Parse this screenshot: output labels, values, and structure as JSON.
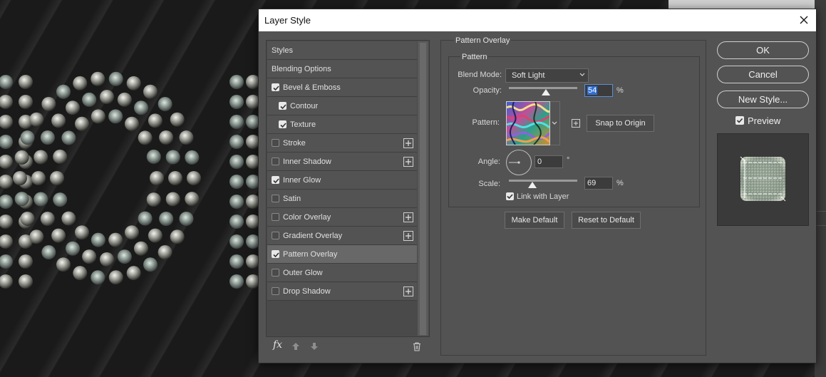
{
  "dialog": {
    "title": "Layer Style"
  },
  "styles_list": [
    {
      "label": "Styles",
      "checkbox": null,
      "plus": false,
      "indent": false,
      "selected": false
    },
    {
      "label": "Blending Options",
      "checkbox": null,
      "plus": false,
      "indent": false,
      "selected": false
    },
    {
      "label": "Bevel & Emboss",
      "checkbox": true,
      "plus": false,
      "indent": false,
      "selected": false
    },
    {
      "label": "Contour",
      "checkbox": true,
      "plus": false,
      "indent": true,
      "selected": false
    },
    {
      "label": "Texture",
      "checkbox": true,
      "plus": false,
      "indent": true,
      "selected": false
    },
    {
      "label": "Stroke",
      "checkbox": false,
      "plus": true,
      "indent": false,
      "selected": false
    },
    {
      "label": "Inner Shadow",
      "checkbox": false,
      "plus": true,
      "indent": false,
      "selected": false
    },
    {
      "label": "Inner Glow",
      "checkbox": true,
      "plus": false,
      "indent": false,
      "selected": false
    },
    {
      "label": "Satin",
      "checkbox": false,
      "plus": false,
      "indent": false,
      "selected": false
    },
    {
      "label": "Color Overlay",
      "checkbox": false,
      "plus": true,
      "indent": false,
      "selected": false
    },
    {
      "label": "Gradient Overlay",
      "checkbox": false,
      "plus": true,
      "indent": false,
      "selected": false
    },
    {
      "label": "Pattern Overlay",
      "checkbox": true,
      "plus": false,
      "indent": false,
      "selected": true
    },
    {
      "label": "Outer Glow",
      "checkbox": false,
      "plus": false,
      "indent": false,
      "selected": false
    },
    {
      "label": "Drop Shadow",
      "checkbox": false,
      "plus": true,
      "indent": false,
      "selected": false
    }
  ],
  "footer": {
    "fx_label": "fx",
    "icons": [
      "fx-icon",
      "move-up-icon",
      "move-down-icon",
      "trash-icon"
    ]
  },
  "pattern_overlay": {
    "group_title": "Pattern Overlay",
    "subgroup_title": "Pattern",
    "blend_mode_label": "Blend Mode:",
    "blend_mode_value": "Soft Light",
    "opacity_label": "Opacity:",
    "opacity_value": "54",
    "opacity_unit": "%",
    "opacity_percent": 54,
    "pattern_label": "Pattern:",
    "snap_button": "Snap to Origin",
    "angle_label": "Angle:",
    "angle_value": "0",
    "angle_unit": "°",
    "scale_label": "Scale:",
    "scale_value": "69",
    "scale_unit": "%",
    "scale_percent": 69,
    "link_label": "Link with Layer",
    "link_checked": true,
    "make_default": "Make Default",
    "reset_default": "Reset to Default"
  },
  "actions": {
    "ok": "OK",
    "cancel": "Cancel",
    "new_style": "New Style...",
    "preview_label": "Preview",
    "preview_checked": true
  },
  "colors": {
    "dialog_bg": "#535353",
    "selected_row": "#686868",
    "focus_blue": "#2f6fd6"
  }
}
